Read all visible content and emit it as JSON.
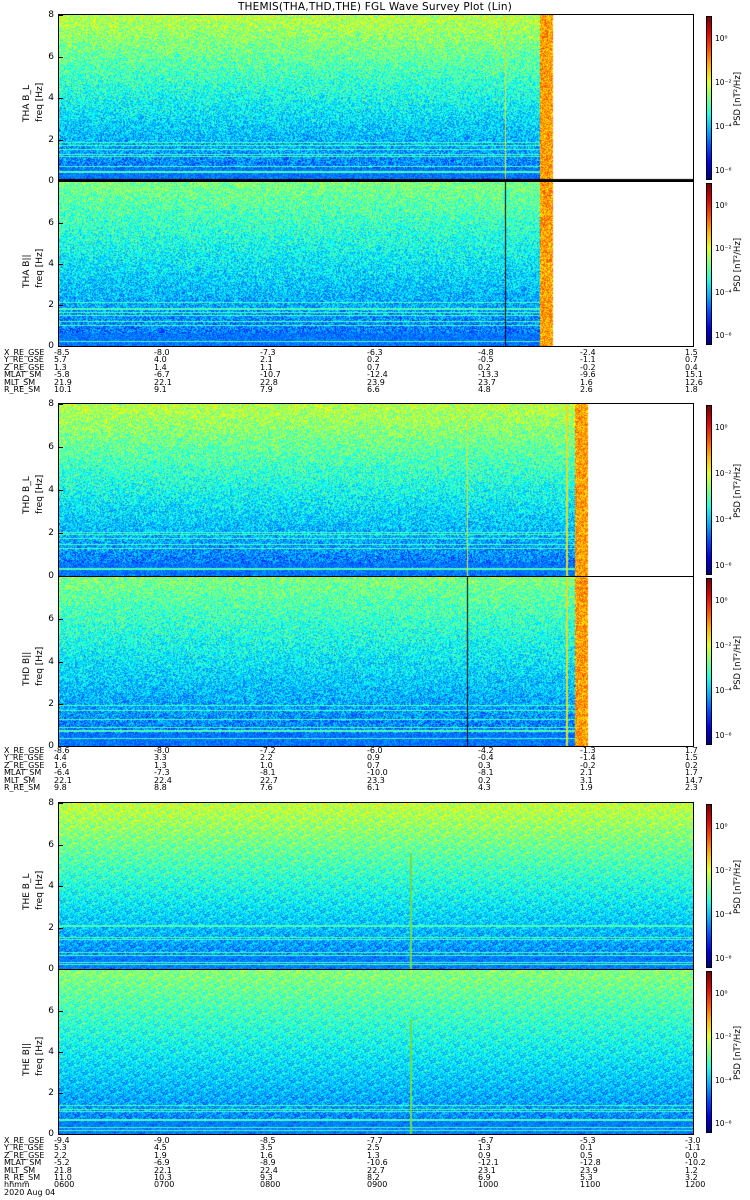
{
  "title": "THEMIS(THA,THD,THE) FGL Wave Survey Plot (Lin)",
  "colorbar": {
    "label": "PSD [nT²/Hz]",
    "ticks": [
      "10⁰",
      "10⁻²",
      "10⁻⁴",
      "10⁻⁶"
    ],
    "scale": "log"
  },
  "chart_data": [
    {
      "type": "heatmap",
      "probe": "tha",
      "panel": "THA B_L",
      "ylabel": "THA B_L\nfreq [Hz]",
      "yticks": [
        "0",
        "2",
        "4",
        "6",
        "8"
      ],
      "ylim": [
        0,
        8
      ],
      "data_end_fraction": 0.78
    },
    {
      "type": "heatmap",
      "probe": "tha",
      "panel": "THA B||",
      "ylabel": "THA B||\nfreq [Hz]",
      "yticks": [
        "0",
        "2",
        "4",
        "6"
      ],
      "ylim": [
        0,
        8
      ],
      "data_end_fraction": 0.78
    },
    {
      "type": "heatmap",
      "probe": "thd",
      "panel": "THD B_L",
      "ylabel": "THD B_L\nfreq [Hz]",
      "yticks": [
        "0",
        "2",
        "4",
        "6",
        "8"
      ],
      "ylim": [
        0,
        8
      ],
      "data_end_fraction": 0.835
    },
    {
      "type": "heatmap",
      "probe": "thd",
      "panel": "THD B||",
      "ylabel": "THD B||\nfreq [Hz]",
      "yticks": [
        "0",
        "2",
        "4",
        "6"
      ],
      "ylim": [
        0,
        8
      ],
      "data_end_fraction": 0.835
    },
    {
      "type": "heatmap",
      "probe": "the",
      "panel": "THE B_L",
      "ylabel": "THE B_L\nfreq [Hz]",
      "yticks": [
        "0",
        "2",
        "4",
        "6",
        "8"
      ],
      "ylim": [
        0,
        8
      ],
      "data_end_fraction": 1.0
    },
    {
      "type": "heatmap",
      "probe": "the",
      "panel": "THE B||",
      "ylabel": "THE B||\nfreq [Hz]",
      "yticks": [
        "0",
        "2",
        "4",
        "6"
      ],
      "ylim": [
        0,
        8
      ],
      "data_end_fraction": 1.0
    }
  ],
  "panels": [
    {
      "ylabel_line1": "THA B_L",
      "ylabel_line2": "freq [Hz]",
      "yticks": [
        "0",
        "2",
        "4",
        "6",
        "8"
      ]
    },
    {
      "ylabel_line1": "THA B||",
      "ylabel_line2": "freq [Hz]",
      "yticks": [
        "0",
        "2",
        "4",
        "6"
      ]
    },
    {
      "ylabel_line1": "THD B_L",
      "ylabel_line2": "freq [Hz]",
      "yticks": [
        "0",
        "2",
        "4",
        "6",
        "8"
      ]
    },
    {
      "ylabel_line1": "THD B||",
      "ylabel_line2": "freq [Hz]",
      "yticks": [
        "0",
        "2",
        "4",
        "6"
      ]
    },
    {
      "ylabel_line1": "THE B_L",
      "ylabel_line2": "freq [Hz]",
      "yticks": [
        "0",
        "2",
        "4",
        "6",
        "8"
      ]
    },
    {
      "ylabel_line1": "THE B||",
      "ylabel_line2": "freq [Hz]",
      "yticks": [
        "0",
        "2",
        "4",
        "6"
      ]
    }
  ],
  "ephemeris": [
    {
      "rows": [
        {
          "name": "X_RE_GSE",
          "values": [
            "-8.5",
            "-8.0",
            "-7.3",
            "-6.3",
            "-4.8",
            "-2.4",
            "1.5"
          ]
        },
        {
          "name": "Y_RE_GSE",
          "values": [
            "5.7",
            "4.0",
            "2.1",
            "0.2",
            "-0.5",
            "-1.1",
            "0.7"
          ]
        },
        {
          "name": "Z_RE_GSE",
          "values": [
            "1.3",
            "1.4",
            "1.1",
            "0.7",
            "0.2",
            "-0.2",
            "0.4"
          ]
        },
        {
          "name": "MLAT_SM",
          "values": [
            "-5.8",
            "-6.7",
            "-10.7",
            "-12.4",
            "-13.3",
            "-9.6",
            "15.1"
          ]
        },
        {
          "name": "MLT_SM",
          "values": [
            "21.9",
            "22.1",
            "22.8",
            "23.9",
            "23.7",
            "1.6",
            "12.6"
          ]
        },
        {
          "name": "R_RE_SM",
          "values": [
            "10.1",
            "9.1",
            "7.9",
            "6.6",
            "4.8",
            "2.6",
            "1.8"
          ]
        }
      ]
    },
    {
      "rows": [
        {
          "name": "X_RE_GSE",
          "values": [
            "-8.6",
            "-8.0",
            "-7.2",
            "-6.0",
            "-4.2",
            "-1.3",
            "1.7"
          ]
        },
        {
          "name": "Y_RE_GSE",
          "values": [
            "4.4",
            "3.3",
            "2.2",
            "0.9",
            "-0.4",
            "-1.4",
            "1.5"
          ]
        },
        {
          "name": "Z_RE_GSE",
          "values": [
            "1.6",
            "1.3",
            "1.0",
            "0.7",
            "0.3",
            "-0.2",
            "0.2"
          ]
        },
        {
          "name": "MLAT_SM",
          "values": [
            "-6.4",
            "-7.3",
            "-8.1",
            "-10.0",
            "-8.1",
            "2.1",
            "1.7"
          ]
        },
        {
          "name": "MLT_SM",
          "values": [
            "22.1",
            "22.4",
            "22.7",
            "23.3",
            "0.2",
            "3.1",
            "14.7"
          ]
        },
        {
          "name": "R_RE_SM",
          "values": [
            "9.8",
            "8.8",
            "7.6",
            "6.1",
            "4.3",
            "1.9",
            "2.3"
          ]
        }
      ]
    },
    {
      "rows": [
        {
          "name": "X_RE_GSE",
          "values": [
            "-9.4",
            "-9.0",
            "-8.5",
            "-7.7",
            "-6.7",
            "-5.3",
            "-3.0"
          ]
        },
        {
          "name": "Y_RE_GSE",
          "values": [
            "5.3",
            "4.5",
            "3.5",
            "2.5",
            "1.3",
            "0.1",
            "-1.1"
          ]
        },
        {
          "name": "Z_RE_GSE",
          "values": [
            "2.2",
            "1.9",
            "1.6",
            "1.3",
            "0.9",
            "0.5",
            "0.0"
          ]
        },
        {
          "name": "MLAT_SM",
          "values": [
            "-5.2",
            "-6.9",
            "-8.9",
            "-10.6",
            "-12.1",
            "-12.8",
            "-10.2"
          ]
        },
        {
          "name": "MLT_SM",
          "values": [
            "21.8",
            "22.1",
            "22.4",
            "22.7",
            "23.1",
            "23.9",
            "1.2"
          ]
        },
        {
          "name": "R_RE_SM",
          "values": [
            "11.0",
            "10.3",
            "9.3",
            "8.2",
            "6.9",
            "5.3",
            "3.2"
          ]
        },
        {
          "name": "hhmm",
          "values": [
            "0600",
            "0700",
            "0800",
            "0900",
            "1000",
            "1100",
            "1200"
          ]
        }
      ]
    }
  ],
  "date": "2020 Aug 04"
}
